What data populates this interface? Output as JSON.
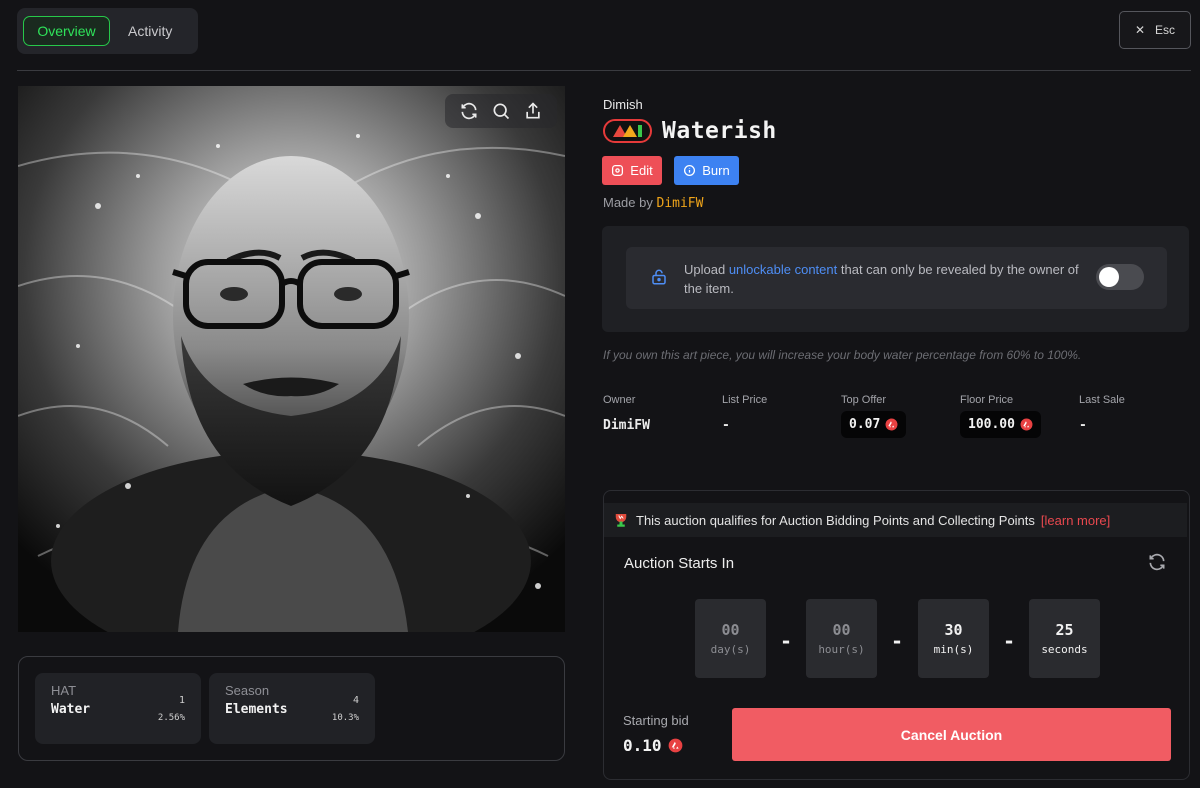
{
  "tabs": [
    {
      "label": "Overview",
      "active": true
    },
    {
      "label": "Activity",
      "active": false
    }
  ],
  "esc": {
    "icon": "close-icon",
    "label": "Esc"
  },
  "artwork": {
    "tools": [
      "refresh-icon",
      "zoom-icon",
      "share-icon"
    ]
  },
  "attributes": [
    {
      "trait": "HAT",
      "value": "Water",
      "count": "1",
      "percent": "2.56%"
    },
    {
      "trait": "Season",
      "value": "Elements",
      "count": "4",
      "percent": "10.3%"
    }
  ],
  "item": {
    "collection": "Dimish",
    "title": "Waterish",
    "edit_label": "Edit",
    "burn_label": "Burn",
    "made_by_prefix": "Made by",
    "creator": "DimiFW"
  },
  "unlockable": {
    "text_before": "Upload",
    "link": "unlockable content",
    "text_after": "that can only be revealed by the owner of the item.",
    "enabled": false
  },
  "description": "If you own this art piece, you will increase your body water percentage from 60% to 100%.",
  "stats": {
    "owner_label": "Owner",
    "owner": "DimiFW",
    "list_price_label": "List Price",
    "list_price": "-",
    "top_offer_label": "Top Offer",
    "top_offer": "0.07",
    "floor_price_label": "Floor Price",
    "floor_price": "100.00",
    "last_sale_label": "Last Sale",
    "last_sale": "-"
  },
  "auction": {
    "points_text": "This auction qualifies for Auction Bidding Points and Collecting Points",
    "learn_more": "[learn more]",
    "starts_in_label": "Auction Starts In",
    "countdown": [
      {
        "value": "00",
        "unit": "day(s)"
      },
      {
        "value": "00",
        "unit": "hour(s)"
      },
      {
        "value": "30",
        "unit": "min(s)"
      },
      {
        "value": "25",
        "unit": "seconds"
      }
    ],
    "separator": "-",
    "starting_bid_label": "Starting bid",
    "starting_bid": "0.10",
    "cancel_label": "Cancel Auction"
  },
  "colors": {
    "accent_green": "#2fe35a",
    "edit_red": "#ee4f57",
    "burn_blue": "#3d82f2",
    "creator_orange": "#f0a51a",
    "cancel_red": "#f15c63"
  }
}
